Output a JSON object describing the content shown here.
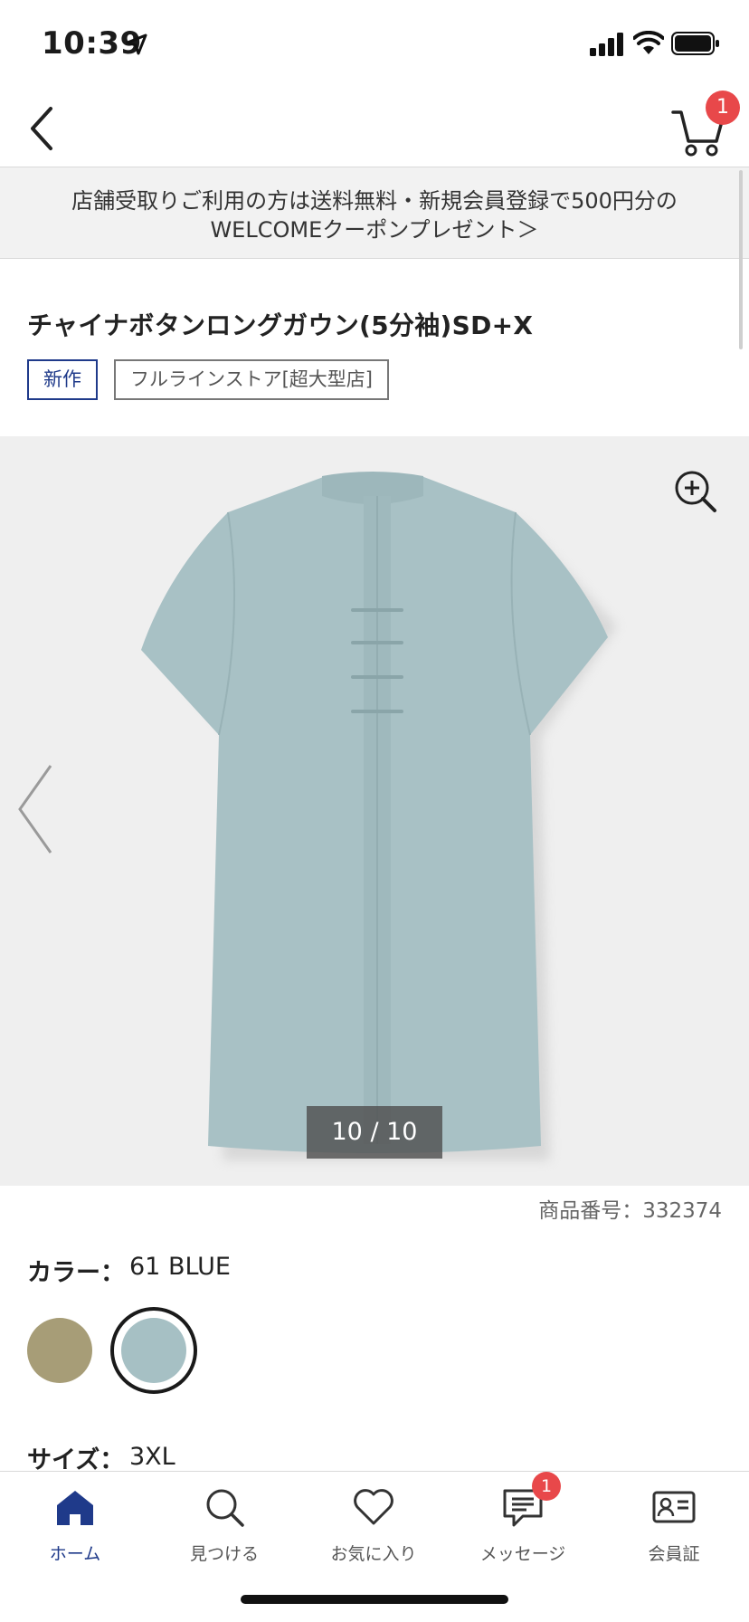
{
  "status_bar": {
    "time": "10:39"
  },
  "nav": {
    "cart_count": "1"
  },
  "promo_banner": {
    "line1": "店舗受取りご利用の方は送料無料・新規会員登録で500円分の",
    "line2": "WELCOMEクーポンプレゼント＞"
  },
  "product": {
    "title": "チャイナボタンロングガウン(5分袖)SD+X",
    "tags": [
      "新作",
      "フルラインストア[超大型店]"
    ],
    "image_counter": "10 / 10",
    "product_number": "商品番号：332374",
    "color_label": "カラー：",
    "color_value": "61 BLUE",
    "swatches": [
      {
        "color": "#a79d77",
        "selected": false
      },
      {
        "color": "#a6c0c4",
        "selected": true
      }
    ],
    "size_label": "サイズ：",
    "size_value": "3XL",
    "garment_color": "#a8c1c5"
  },
  "tab_bar": {
    "items": [
      {
        "label": "ホーム",
        "icon": "home-icon",
        "active": true
      },
      {
        "label": "見つける",
        "icon": "search-icon",
        "active": false
      },
      {
        "label": "お気に入り",
        "icon": "heart-icon",
        "active": false
      },
      {
        "label": "メッセージ",
        "icon": "message-icon",
        "active": false,
        "badge": "1"
      },
      {
        "label": "会員証",
        "icon": "member-card-icon",
        "active": false
      }
    ]
  },
  "colors": {
    "accent": "#1f3a8a",
    "badge": "#e8484a"
  }
}
